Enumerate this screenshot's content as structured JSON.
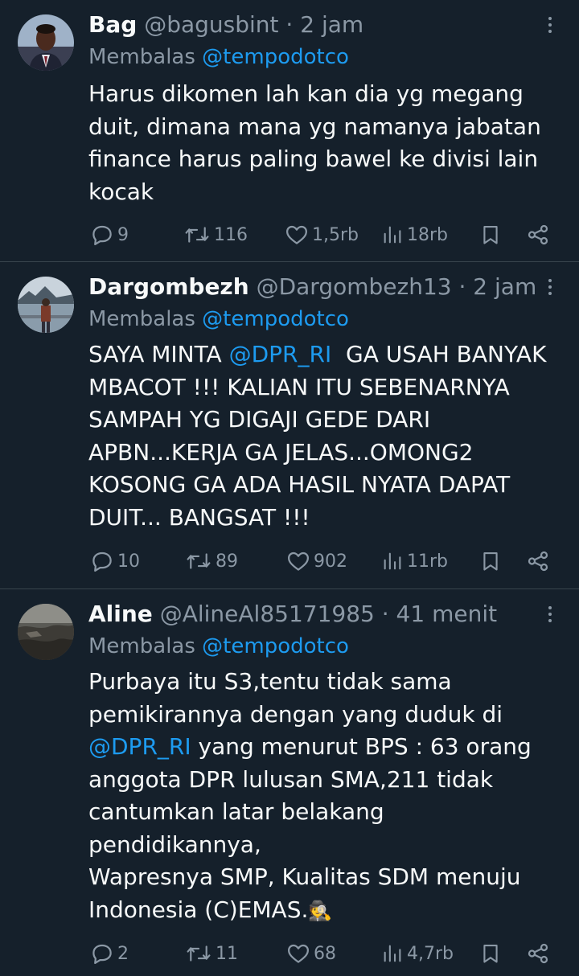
{
  "tweets": [
    {
      "name": "Bag",
      "handle": "@bagusbint",
      "time": "· 2 jam",
      "reply_prefix": "Membalas",
      "reply_to": "@tempodotco",
      "lines": [
        "Harus dikomen lah kan dia yg megang",
        "duit, dimana mana yg namanya jabatan",
        "finance harus paling bawel ke divisi lain",
        "kocak"
      ],
      "replies": "9",
      "retweets": "116",
      "likes": "1,5rb",
      "views": "18rb"
    },
    {
      "name": "Dargombezh",
      "handle": "@Dargombezh13",
      "time": "· 2 jam",
      "reply_prefix": "Membalas",
      "reply_to": "@tempodotco",
      "line1_pre": "SAYA MINTA ",
      "line1_mention": "@DPR_RI",
      "line1_post": "  GA USAH BANYAK",
      "lines": [
        "MBACOT !!! KALIAN ITU SEBENARNYA",
        "SAMPAH YG DIGAJI GEDE DARI",
        "APBN...KERJA GA JELAS...OMONG2",
        "KOSONG GA ADA HASIL NYATA DAPAT",
        "DUIT... BANGSAT !!!"
      ],
      "replies": "10",
      "retweets": "89",
      "likes": "902",
      "views": "11rb"
    },
    {
      "name": "Aline",
      "handle": "@AlineAl85171985",
      "time": "· 41 menit",
      "reply_prefix": "Membalas",
      "reply_to": "@tempodotco",
      "lines_a": [
        "Purbaya itu S3,tentu tidak sama",
        "pemikirannya dengan yang duduk di"
      ],
      "line3_mention": "@DPR_RI",
      "line3_post": " yang menurut BPS : 63 orang",
      "lines_b": [
        "anggota DPR lulusan SMA,211 tidak",
        "cantumkan latar belakang",
        "pendidikannya,",
        "Wapresnya SMP, Kualitas SDM menuju"
      ],
      "last_line": "Indonesia (C)EMAS.",
      "emoji": "🕵",
      "replies": "2",
      "retweets": "11",
      "likes": "68",
      "views": "4,7rb"
    }
  ],
  "colors": {
    "background": "#15202b",
    "text": "#f7f9f9",
    "secondary": "#8b98a5",
    "link": "#1d9bf0",
    "divider": "#38444d"
  },
  "icons": [
    "reply-icon",
    "retweet-icon",
    "like-icon",
    "views-icon",
    "bookmark-icon",
    "share-icon",
    "more-icon"
  ]
}
